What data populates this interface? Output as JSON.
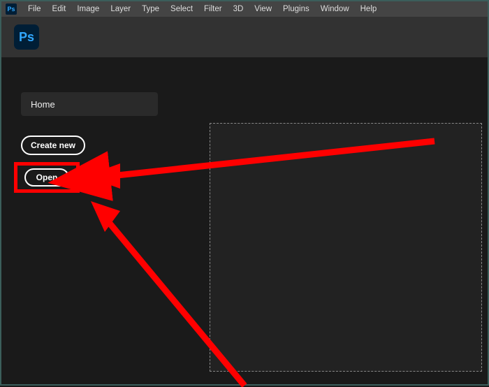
{
  "menubar": {
    "logo": "Ps",
    "items": [
      "File",
      "Edit",
      "Image",
      "Layer",
      "Type",
      "Select",
      "Filter",
      "3D",
      "View",
      "Plugins",
      "Window",
      "Help"
    ]
  },
  "app": {
    "logo_text": "Ps"
  },
  "home": {
    "label": "Home"
  },
  "buttons": {
    "create_new": "Create new",
    "open": "Open"
  },
  "annotation": {
    "highlight_color": "#ff0000",
    "arrow_color": "#ff0000"
  }
}
